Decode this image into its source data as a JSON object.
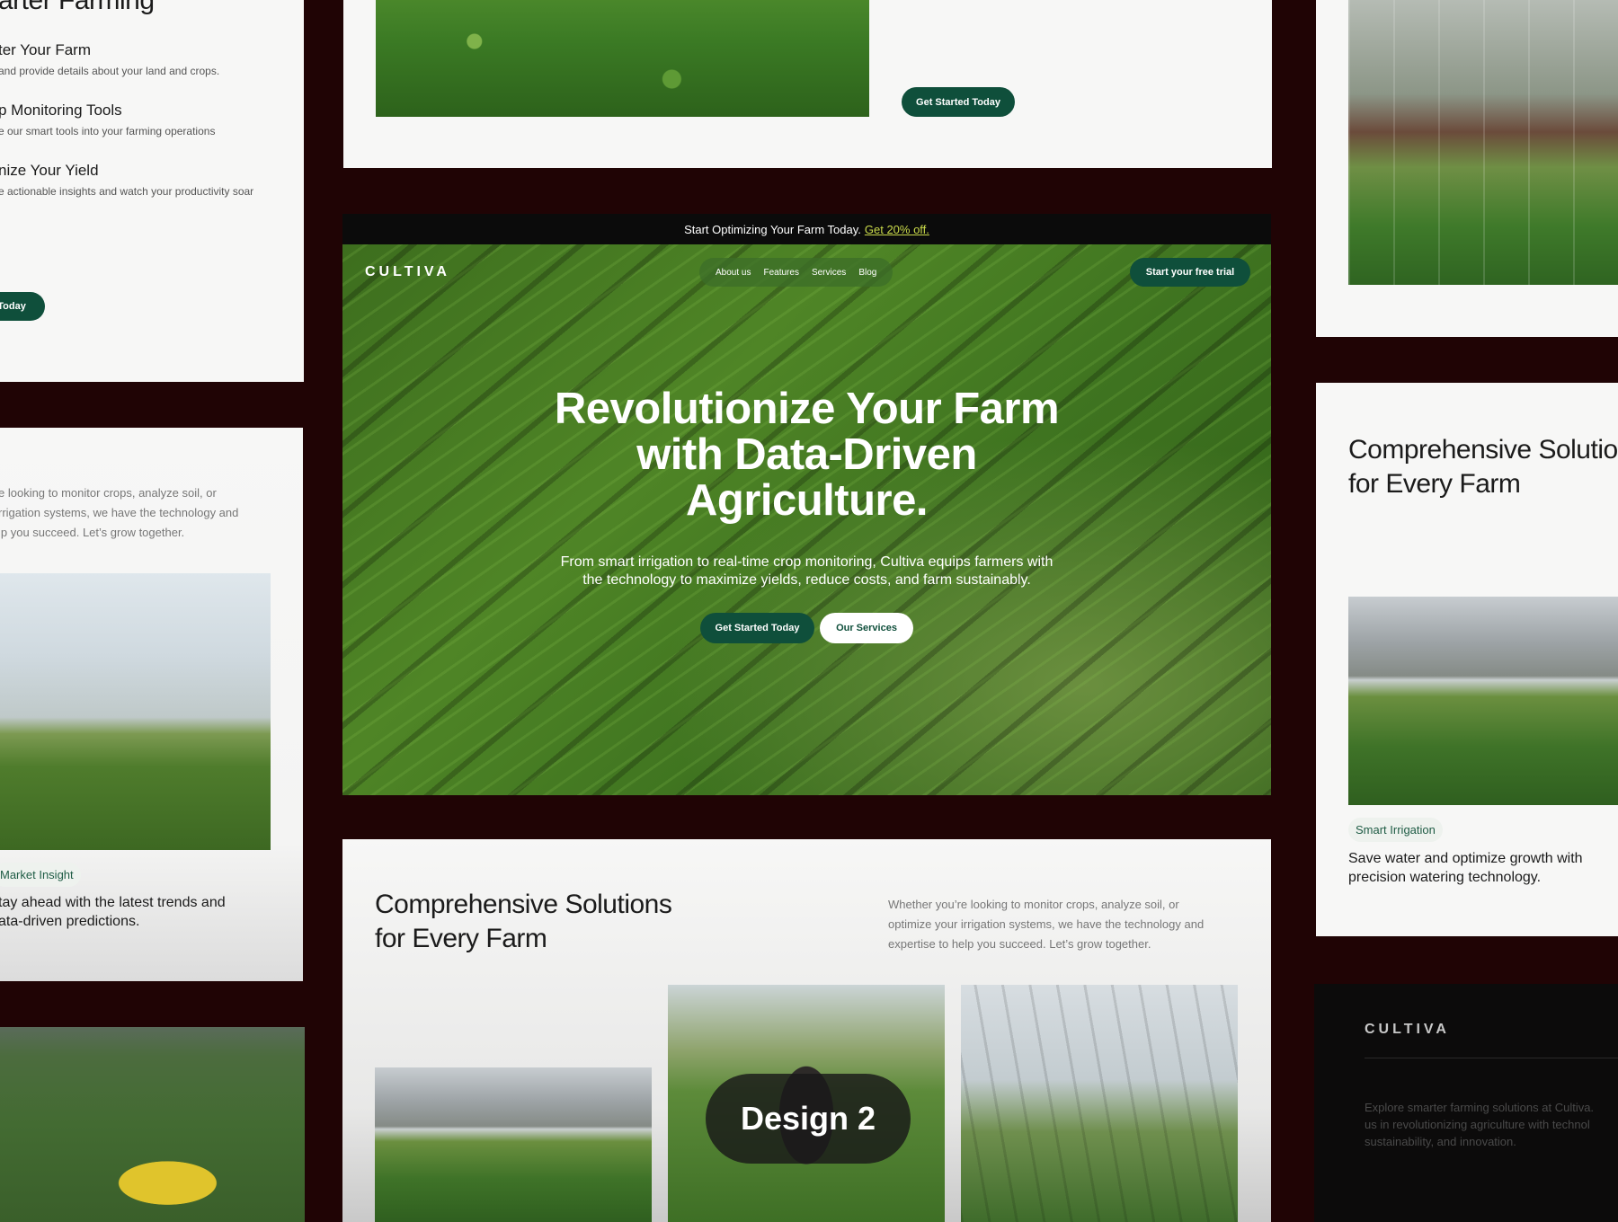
{
  "left_top": {
    "heading": "arter Farming",
    "steps": [
      {
        "title": "ter Your Farm",
        "desc": "and provide details about your land and crops."
      },
      {
        "title": "p Monitoring Tools",
        "desc": "e our smart tools into your farming operations"
      },
      {
        "title": "nize Your Yield",
        "desc": "e actionable insights and watch your productivity soar"
      }
    ],
    "button": "l Today"
  },
  "left_mid": {
    "paragraph_lines": [
      "e looking to monitor crops, analyze soil, or",
      "rrigation systems, we have the technology and",
      "lp you succeed. Let’s grow together."
    ],
    "tag": "Market Insight",
    "card_lines": [
      "tay ahead with the latest trends and",
      "ata-driven predictions."
    ]
  },
  "center_top": {
    "button": "Get Started Today"
  },
  "hero": {
    "banner_text": "Start Optimizing Your Farm Today.",
    "banner_link": "Get 20% off.",
    "logo": "CULTIVA",
    "nav": [
      "About us",
      "Features",
      "Services",
      "Blog"
    ],
    "trial_button": "Start your free trial",
    "title_lines": [
      "Revolutionize Your Farm",
      "with Data-Driven",
      "Agriculture."
    ],
    "subtitle_lines": [
      "From smart irrigation to real-time crop monitoring, Cultiva equips farmers with",
      "the technology to maximize yields, reduce costs, and farm sustainably."
    ],
    "primary_button": "Get Started Today",
    "secondary_button": "Our Services"
  },
  "center_bottom": {
    "title_lines": [
      "Comprehensive Solutions",
      "for Every Farm"
    ],
    "paragraph_lines": [
      "Whether you’re looking to monitor crops, analyze soil, or",
      "optimize your irrigation systems, we have the technology and",
      "expertise to help you succeed. Let’s grow together."
    ],
    "overlay_badge": "Design 2"
  },
  "right_mid": {
    "title_lines": [
      "Comprehensive Solutio",
      "for Every Farm"
    ],
    "tag": "Smart Irrigation",
    "card_lines": [
      "Save water and optimize growth with",
      "precision watering technology."
    ]
  },
  "right_bottom": {
    "logo": "CULTIVA",
    "paragraph_lines": [
      "Explore smarter farming solutions at Cultiva.",
      "us in revolutionizing agriculture with technol",
      "sustainability, and innovation."
    ]
  },
  "colors": {
    "page_background": "#200405",
    "brand_green": "#0f4f3b",
    "panel_white": "#f7f7f6",
    "banner_link": "#c9d94a"
  }
}
